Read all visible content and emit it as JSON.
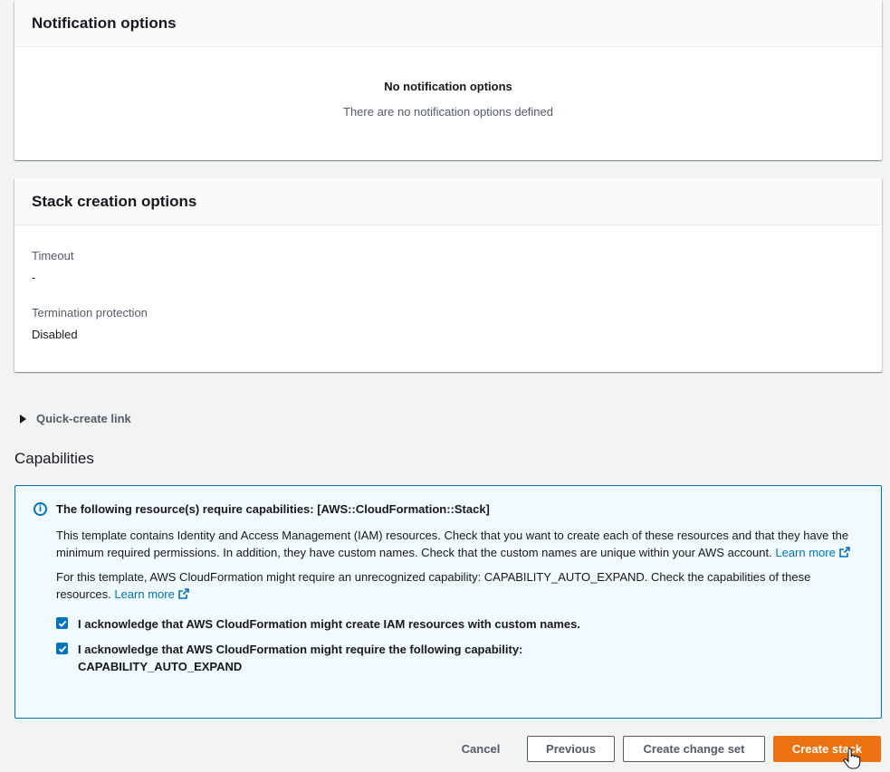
{
  "notification": {
    "title": "Notification options",
    "empty_title": "No notification options",
    "empty_desc": "There are no notification options defined"
  },
  "stack_creation": {
    "title": "Stack creation options",
    "timeout_label": "Timeout",
    "timeout_value": "-",
    "termination_label": "Termination protection",
    "termination_value": "Disabled"
  },
  "quick_create": {
    "label": "Quick-create link"
  },
  "capabilities": {
    "title": "Capabilities",
    "header": "The following resource(s) require capabilities: [AWS::CloudFormation::Stack]",
    "para1": "This template contains Identity and Access Management (IAM) resources. Check that you want to create each of these resources and that they have the minimum required permissions. In addition, they have custom names. Check that the custom names are unique within your AWS account.",
    "para2": "For this template, AWS CloudFormation might require an unrecognized capability: CAPABILITY_AUTO_EXPAND. Check the capabilities of these resources.",
    "learn_more": "Learn more",
    "ack1": "I acknowledge that AWS CloudFormation might create IAM resources with custom names.",
    "ack2": "I acknowledge that AWS CloudFormation might require the following capability: CAPABILITY_AUTO_EXPAND",
    "ack1_checked": true,
    "ack2_checked": true
  },
  "footer": {
    "cancel": "Cancel",
    "previous": "Previous",
    "create_change_set": "Create change set",
    "create_stack": "Create stack"
  },
  "colors": {
    "primary": "#ec7211",
    "link": "#0073bb",
    "info_bg": "#f1faff"
  },
  "icons": {
    "caret": "caret-right-icon",
    "info": "info-icon",
    "external": "external-link-icon",
    "check": "checkmark-icon",
    "cursor": "hand-pointer-cursor"
  }
}
